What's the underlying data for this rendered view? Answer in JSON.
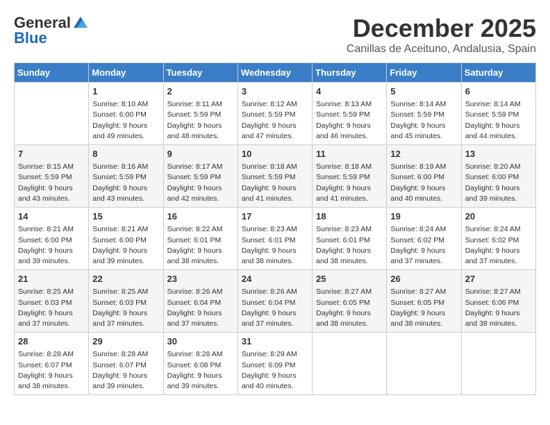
{
  "header": {
    "logo_general": "General",
    "logo_blue": "Blue",
    "month_year": "December 2025",
    "location": "Canillas de Aceituno, Andalusia, Spain"
  },
  "weekdays": [
    "Sunday",
    "Monday",
    "Tuesday",
    "Wednesday",
    "Thursday",
    "Friday",
    "Saturday"
  ],
  "weeks": [
    [
      {
        "day": "",
        "sunrise": "",
        "sunset": "",
        "daylight": ""
      },
      {
        "day": "1",
        "sunrise": "Sunrise: 8:10 AM",
        "sunset": "Sunset: 6:00 PM",
        "daylight": "Daylight: 9 hours and 49 minutes."
      },
      {
        "day": "2",
        "sunrise": "Sunrise: 8:11 AM",
        "sunset": "Sunset: 5:59 PM",
        "daylight": "Daylight: 9 hours and 48 minutes."
      },
      {
        "day": "3",
        "sunrise": "Sunrise: 8:12 AM",
        "sunset": "Sunset: 5:59 PM",
        "daylight": "Daylight: 9 hours and 47 minutes."
      },
      {
        "day": "4",
        "sunrise": "Sunrise: 8:13 AM",
        "sunset": "Sunset: 5:59 PM",
        "daylight": "Daylight: 9 hours and 46 minutes."
      },
      {
        "day": "5",
        "sunrise": "Sunrise: 8:14 AM",
        "sunset": "Sunset: 5:59 PM",
        "daylight": "Daylight: 9 hours and 45 minutes."
      },
      {
        "day": "6",
        "sunrise": "Sunrise: 8:14 AM",
        "sunset": "Sunset: 5:59 PM",
        "daylight": "Daylight: 9 hours and 44 minutes."
      }
    ],
    [
      {
        "day": "7",
        "sunrise": "Sunrise: 8:15 AM",
        "sunset": "Sunset: 5:59 PM",
        "daylight": "Daylight: 9 hours and 43 minutes."
      },
      {
        "day": "8",
        "sunrise": "Sunrise: 8:16 AM",
        "sunset": "Sunset: 5:59 PM",
        "daylight": "Daylight: 9 hours and 43 minutes."
      },
      {
        "day": "9",
        "sunrise": "Sunrise: 8:17 AM",
        "sunset": "Sunset: 5:59 PM",
        "daylight": "Daylight: 9 hours and 42 minutes."
      },
      {
        "day": "10",
        "sunrise": "Sunrise: 8:18 AM",
        "sunset": "Sunset: 5:59 PM",
        "daylight": "Daylight: 9 hours and 41 minutes."
      },
      {
        "day": "11",
        "sunrise": "Sunrise: 8:18 AM",
        "sunset": "Sunset: 5:59 PM",
        "daylight": "Daylight: 9 hours and 41 minutes."
      },
      {
        "day": "12",
        "sunrise": "Sunrise: 8:19 AM",
        "sunset": "Sunset: 6:00 PM",
        "daylight": "Daylight: 9 hours and 40 minutes."
      },
      {
        "day": "13",
        "sunrise": "Sunrise: 8:20 AM",
        "sunset": "Sunset: 6:00 PM",
        "daylight": "Daylight: 9 hours and 39 minutes."
      }
    ],
    [
      {
        "day": "14",
        "sunrise": "Sunrise: 8:21 AM",
        "sunset": "Sunset: 6:00 PM",
        "daylight": "Daylight: 9 hours and 39 minutes."
      },
      {
        "day": "15",
        "sunrise": "Sunrise: 8:21 AM",
        "sunset": "Sunset: 6:00 PM",
        "daylight": "Daylight: 9 hours and 39 minutes."
      },
      {
        "day": "16",
        "sunrise": "Sunrise: 8:22 AM",
        "sunset": "Sunset: 6:01 PM",
        "daylight": "Daylight: 9 hours and 38 minutes."
      },
      {
        "day": "17",
        "sunrise": "Sunrise: 8:23 AM",
        "sunset": "Sunset: 6:01 PM",
        "daylight": "Daylight: 9 hours and 38 minutes."
      },
      {
        "day": "18",
        "sunrise": "Sunrise: 8:23 AM",
        "sunset": "Sunset: 6:01 PM",
        "daylight": "Daylight: 9 hours and 38 minutes."
      },
      {
        "day": "19",
        "sunrise": "Sunrise: 8:24 AM",
        "sunset": "Sunset: 6:02 PM",
        "daylight": "Daylight: 9 hours and 37 minutes."
      },
      {
        "day": "20",
        "sunrise": "Sunrise: 8:24 AM",
        "sunset": "Sunset: 6:02 PM",
        "daylight": "Daylight: 9 hours and 37 minutes."
      }
    ],
    [
      {
        "day": "21",
        "sunrise": "Sunrise: 8:25 AM",
        "sunset": "Sunset: 6:03 PM",
        "daylight": "Daylight: 9 hours and 37 minutes."
      },
      {
        "day": "22",
        "sunrise": "Sunrise: 8:25 AM",
        "sunset": "Sunset: 6:03 PM",
        "daylight": "Daylight: 9 hours and 37 minutes."
      },
      {
        "day": "23",
        "sunrise": "Sunrise: 8:26 AM",
        "sunset": "Sunset: 6:04 PM",
        "daylight": "Daylight: 9 hours and 37 minutes."
      },
      {
        "day": "24",
        "sunrise": "Sunrise: 8:26 AM",
        "sunset": "Sunset: 6:04 PM",
        "daylight": "Daylight: 9 hours and 37 minutes."
      },
      {
        "day": "25",
        "sunrise": "Sunrise: 8:27 AM",
        "sunset": "Sunset: 6:05 PM",
        "daylight": "Daylight: 9 hours and 38 minutes."
      },
      {
        "day": "26",
        "sunrise": "Sunrise: 8:27 AM",
        "sunset": "Sunset: 6:05 PM",
        "daylight": "Daylight: 9 hours and 38 minutes."
      },
      {
        "day": "27",
        "sunrise": "Sunrise: 8:27 AM",
        "sunset": "Sunset: 6:06 PM",
        "daylight": "Daylight: 9 hours and 38 minutes."
      }
    ],
    [
      {
        "day": "28",
        "sunrise": "Sunrise: 8:28 AM",
        "sunset": "Sunset: 6:07 PM",
        "daylight": "Daylight: 9 hours and 38 minutes."
      },
      {
        "day": "29",
        "sunrise": "Sunrise: 8:28 AM",
        "sunset": "Sunset: 6:07 PM",
        "daylight": "Daylight: 9 hours and 39 minutes."
      },
      {
        "day": "30",
        "sunrise": "Sunrise: 8:28 AM",
        "sunset": "Sunset: 6:08 PM",
        "daylight": "Daylight: 9 hours and 39 minutes."
      },
      {
        "day": "31",
        "sunrise": "Sunrise: 8:29 AM",
        "sunset": "Sunset: 6:09 PM",
        "daylight": "Daylight: 9 hours and 40 minutes."
      },
      {
        "day": "",
        "sunrise": "",
        "sunset": "",
        "daylight": ""
      },
      {
        "day": "",
        "sunrise": "",
        "sunset": "",
        "daylight": ""
      },
      {
        "day": "",
        "sunrise": "",
        "sunset": "",
        "daylight": ""
      }
    ]
  ]
}
